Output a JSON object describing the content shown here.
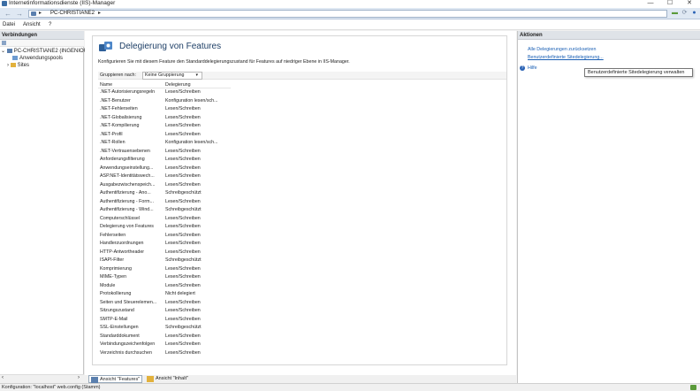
{
  "window": {
    "title": "Internetinformationsdienste (IIS)-Manager",
    "minimize": "—",
    "maximize": "☐",
    "close": "✕"
  },
  "address": {
    "back": "←",
    "forward": "→",
    "crumb": "PC-CHRISTIANE2",
    "sep": "▸"
  },
  "menu": [
    "Datei",
    "Ansicht",
    "?"
  ],
  "connections": {
    "header": "Verbindungen",
    "root": "PC-CHRISTIANE2 (INGENIOU",
    "children": [
      "Anwendungspools",
      "Sites"
    ]
  },
  "main": {
    "title": "Delegierung von Features",
    "description": "Konfigurieren Sie mit diesem Feature den Standarddelegierungszustand für Features auf niedriger Ebene in IIS-Manager.",
    "group_label": "Gruppieren nach:",
    "group_value": "Keine Gruppierung",
    "columns": [
      "Name",
      "Delegierung"
    ],
    "rows": [
      [
        ".NET-Autorisierungsregeln",
        "Lesen/Schreiben"
      ],
      [
        ".NET-Benutzer",
        "Konfiguration lesen/sch..."
      ],
      [
        ".NET-Fehlerseiten",
        "Lesen/Schreiben"
      ],
      [
        ".NET-Globalisierung",
        "Lesen/Schreiben"
      ],
      [
        ".NET-Kompilierung",
        "Lesen/Schreiben"
      ],
      [
        ".NET-Profil",
        "Lesen/Schreiben"
      ],
      [
        ".NET-Rollen",
        "Konfiguration lesen/sch..."
      ],
      [
        ".NET-Vertrauensebenen",
        "Lesen/Schreiben"
      ],
      [
        "Anforderungsfilterung",
        "Lesen/Schreiben"
      ],
      [
        "Anwendungseinstellung...",
        "Lesen/Schreiben"
      ],
      [
        "ASP.NET-Identitätswech...",
        "Lesen/Schreiben"
      ],
      [
        "Ausgabezwischenspeich...",
        "Lesen/Schreiben"
      ],
      [
        "Authentifizierung - Ano...",
        "Schreibgeschützt"
      ],
      [
        "Authentifizierung - Form...",
        "Lesen/Schreiben"
      ],
      [
        "Authentifizierung - Wind...",
        "Schreibgeschützt"
      ],
      [
        "Computerschlüssel",
        "Lesen/Schreiben"
      ],
      [
        "Delegierung von Features",
        "Lesen/Schreiben"
      ],
      [
        "Fehlerseiten",
        "Lesen/Schreiben"
      ],
      [
        "Handlerzuordnungen",
        "Lesen/Schreiben"
      ],
      [
        "HTTP-Antwortheader",
        "Lesen/Schreiben"
      ],
      [
        "ISAPI-Filter",
        "Schreibgeschützt"
      ],
      [
        "Komprimierung",
        "Lesen/Schreiben"
      ],
      [
        "MIME-Typen",
        "Lesen/Schreiben"
      ],
      [
        "Module",
        "Lesen/Schreiben"
      ],
      [
        "Protokollierung",
        "Nicht delegiert"
      ],
      [
        "Seiten und Steuerelemen...",
        "Lesen/Schreiben"
      ],
      [
        "Sitzungszustand",
        "Lesen/Schreiben"
      ],
      [
        "SMTP-E-Mail",
        "Lesen/Schreiben"
      ],
      [
        "SSL-Einstellungen",
        "Schreibgeschützt"
      ],
      [
        "Standarddokument",
        "Lesen/Schreiben"
      ],
      [
        "Verbindungszeichenfolgen",
        "Lesen/Schreiben"
      ],
      [
        "Verzeichnis durchsuchen",
        "Lesen/Schreiben"
      ]
    ]
  },
  "bottom_tabs": [
    "Ansicht \"Features\"",
    "Ansicht \"Inhalt\""
  ],
  "actions": {
    "header": "Aktionen",
    "links": [
      "Alle Delegierungen zurücksetzen",
      "Benutzerdefinierte Sitedelegierung..."
    ],
    "help": "Hilfe",
    "tooltip": "Benutzerdefinierte Sitedelegierung verwalten"
  },
  "status": "Konfiguration: \"localhost\" web.config (Stamm)",
  "colors": {
    "title_blue": "#1e3f66",
    "link_blue": "#1a5fb4",
    "address_bg": "#dfe8f3"
  }
}
